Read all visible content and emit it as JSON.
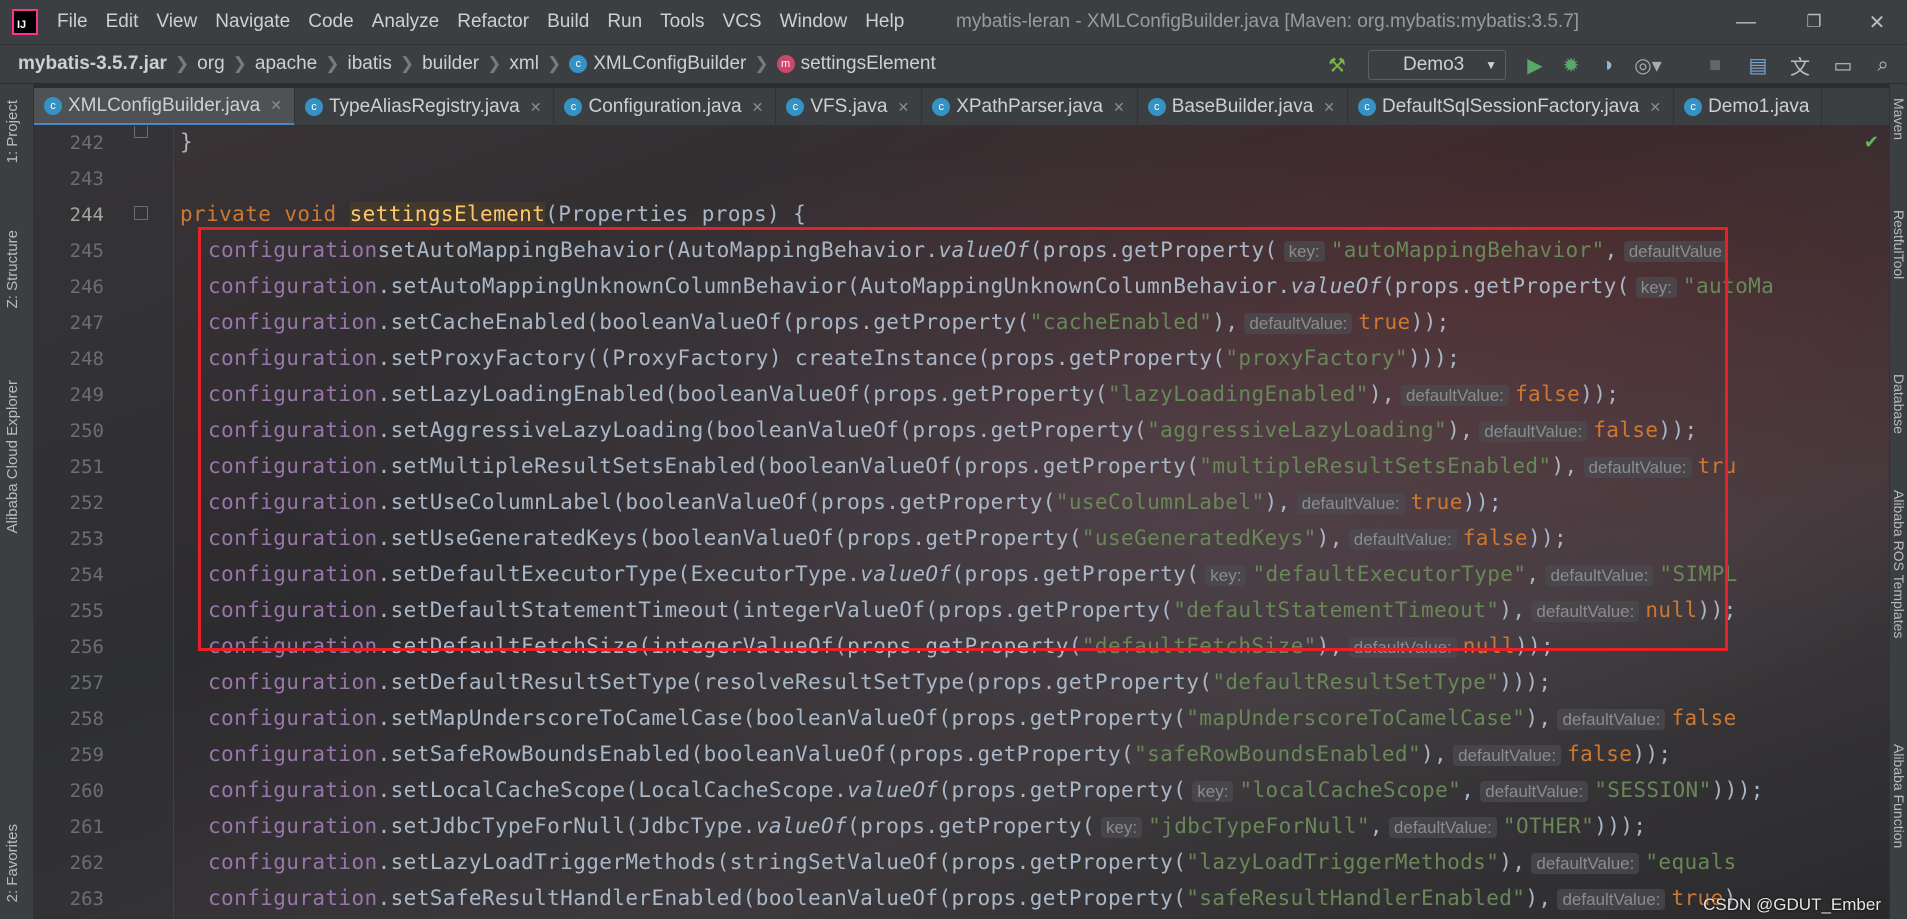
{
  "titlebar": {
    "menu": [
      "File",
      "Edit",
      "View",
      "Navigate",
      "Code",
      "Analyze",
      "Refactor",
      "Build",
      "Run",
      "Tools",
      "VCS",
      "Window",
      "Help"
    ],
    "title": "mybatis-leran - XMLConfigBuilder.java [Maven: org.mybatis:mybatis:3.5.7]",
    "logo": "IJ"
  },
  "breadcrumb": [
    "mybatis-3.5.7.jar",
    "org",
    "apache",
    "ibatis",
    "builder",
    "xml",
    "XMLConfigBuilder",
    "settingsElement"
  ],
  "run_config": "Demo3",
  "tabs": [
    "XMLConfigBuilder.java",
    "TypeAliasRegistry.java",
    "Configuration.java",
    "VFS.java",
    "XPathParser.java",
    "BaseBuilder.java",
    "DefaultSqlSessionFactory.java",
    "Demo1.java"
  ],
  "left_tools": [
    "1: Project",
    "Z: Structure",
    "Alibaba Cloud Explorer",
    "2: Favorites"
  ],
  "right_tools": [
    "Maven",
    "RestfulTool",
    "Database",
    "Alibaba ROS Templates",
    "Alibaba Function"
  ],
  "line_numbers": [
    "242",
    "243",
    "244",
    "245",
    "246",
    "247",
    "248",
    "249",
    "250",
    "251",
    "252",
    "253",
    "254",
    "255",
    "256",
    "257",
    "258",
    "259",
    "260",
    "261",
    "262",
    "263"
  ],
  "code": {
    "l242": "}",
    "l244": {
      "kw1": "private",
      "kw2": "void",
      "name": "settingsElement",
      "params": "(Properties props) {"
    },
    "l245": {
      "obj": "configuration",
      ".": ".",
      "call": "setAutoMappingBehavior(AutoMappingBehavior.",
      "static": "valueOf",
      "rest": "(props.getProperty(",
      "hint1": "key:",
      "str": "\"autoMappingBehavior\"",
      ",": ",",
      "hint2": "defaultValue"
    },
    "l246": {
      "obj": "configuration",
      "call": ".setAutoMappingUnknownColumnBehavior(AutoMappingUnknownColumnBehavior.",
      "static": "valueOf",
      "rest": "(props.getProperty(",
      "hint1": "key:",
      "str": "\"autoMa"
    },
    "l247": {
      "obj": "configuration",
      "call": ".setCacheEnabled(booleanValueOf(props.getProperty(",
      "str": "\"cacheEnabled\"",
      "sep": "),",
      "hint": "defaultValue:",
      "kw": "true",
      "end": "));"
    },
    "l248": {
      "obj": "configuration",
      "call": ".setProxyFactory((ProxyFactory) createInstance(props.getProperty(",
      "str": "\"proxyFactory\"",
      "end": ")));"
    },
    "l249": {
      "obj": "configuration",
      "call": ".setLazyLoadingEnabled(booleanValueOf(props.getProperty(",
      "str": "\"lazyLoadingEnabled\"",
      "sep": "),",
      "hint": "defaultValue:",
      "kw": "false",
      "end": "));"
    },
    "l250": {
      "obj": "configuration",
      "call": ".setAggressiveLazyLoading(booleanValueOf(props.getProperty(",
      "str": "\"aggressiveLazyLoading\"",
      "sep": "),",
      "hint": "defaultValue:",
      "kw": "false",
      "end": "));"
    },
    "l251": {
      "obj": "configuration",
      "call": ".setMultipleResultSetsEnabled(booleanValueOf(props.getProperty(",
      "str": "\"multipleResultSetsEnabled\"",
      "sep": "),",
      "hint": "defaultValue:",
      "kw": "tru"
    },
    "l252": {
      "obj": "configuration",
      "call": ".setUseColumnLabel(booleanValueOf(props.getProperty(",
      "str": "\"useColumnLabel\"",
      "sep": "),",
      "hint": "defaultValue:",
      "kw": "true",
      "end": "));"
    },
    "l253": {
      "obj": "configuration",
      "call": ".setUseGeneratedKeys(booleanValueOf(props.getProperty(",
      "str": "\"useGeneratedKeys\"",
      "sep": "),",
      "hint": "defaultValue:",
      "kw": "false",
      "end": "));"
    },
    "l254": {
      "obj": "configuration",
      "call": ".setDefaultExecutorType(ExecutorType.",
      "static": "valueOf",
      "rest": "(props.getProperty(",
      "hint1": "key:",
      "str": "\"defaultExecutorType\"",
      "sep": ",",
      "hint2": "defaultValue:",
      "str2": "\"SIMPL"
    },
    "l255": {
      "obj": "configuration",
      "call": ".setDefaultStatementTimeout(integerValueOf(props.getProperty(",
      "str": "\"defaultStatementTimeout\"",
      "sep": "),",
      "hint": "defaultValue:",
      "kw": "null",
      "end": "));"
    },
    "l256": {
      "obj": "configuration",
      "call": ".setDefaultFetchSize(integerValueOf(props.getProperty(",
      "str": "\"defaultFetchSize\"",
      "sep": "),",
      "hint": "defaultValue:",
      "kw": "null",
      "end": "));"
    },
    "l257": {
      "obj": "configuration",
      "call": ".setDefaultResultSetType(resolveResultSetType(props.getProperty(",
      "str": "\"defaultResultSetType\"",
      "end": ")));"
    },
    "l258": {
      "obj": "configuration",
      "call": ".setMapUnderscoreToCamelCase(booleanValueOf(props.getProperty(",
      "str": "\"mapUnderscoreToCamelCase\"",
      "sep": "),",
      "hint": "defaultValue:",
      "kw": "false"
    },
    "l259": {
      "obj": "configuration",
      "call": ".setSafeRowBoundsEnabled(booleanValueOf(props.getProperty(",
      "str": "\"safeRowBoundsEnabled\"",
      "sep": "),",
      "hint": "defaultValue:",
      "kw": "false",
      "end": "));"
    },
    "l260": {
      "obj": "configuration",
      "call": ".setLocalCacheScope(LocalCacheScope.",
      "static": "valueOf",
      "rest": "(props.getProperty(",
      "hint1": "key:",
      "str": "\"localCacheScope\"",
      "sep": ",",
      "hint2": "defaultValue:",
      "str2": "\"SESSION\"",
      "end": ")));"
    },
    "l261": {
      "obj": "configuration",
      "call": ".setJdbcTypeForNull(JdbcType.",
      "static": "valueOf",
      "rest": "(props.getProperty(",
      "hint1": "key:",
      "str": "\"jdbcTypeForNull\"",
      "sep": ",",
      "hint2": "defaultValue:",
      "str2": "\"OTHER\"",
      "end": ")));"
    },
    "l262": {
      "obj": "configuration",
      "call": ".setLazyLoadTriggerMethods(stringSetValueOf(props.getProperty(",
      "str": "\"lazyLoadTriggerMethods\"",
      "sep": "),",
      "hint": "defaultValue:",
      "str2": "\"equals"
    },
    "l263": {
      "obj": "configuration",
      "call": ".setSafeResultHandlerEnabled(booleanValueOf(props.getProperty(",
      "str": "\"safeResultHandlerEnabled\"",
      "sep": "),",
      "hint": "defaultValue:",
      "kw": "true",
      "end": ")"
    }
  },
  "watermark": "CSDN @GDUT_Ember",
  "colors": {
    "keyword": "#cc7832",
    "field": "#9876aa",
    "string": "#6a8759",
    "method_decl": "#ffc66d",
    "highlight_box": "#e8202a"
  }
}
